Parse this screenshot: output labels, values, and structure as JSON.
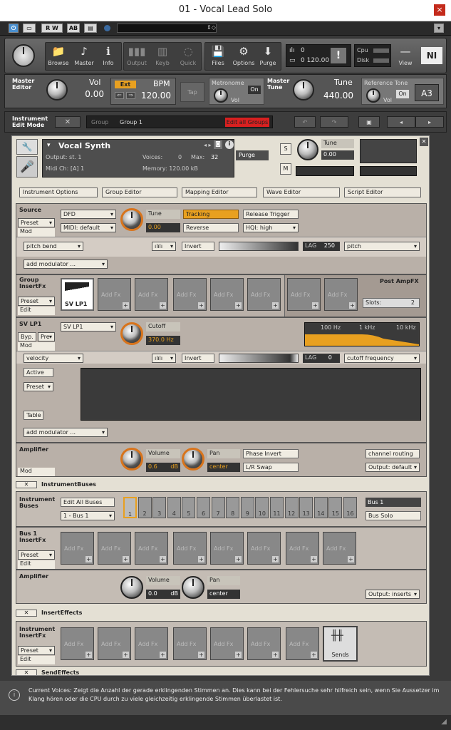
{
  "window": {
    "title": "01 - Vocal Lead Solo",
    "close": "×"
  },
  "toolbar": {
    "rw": "R W",
    "ab": "AB"
  },
  "tools": [
    {
      "label": "Browse",
      "icon": "📁"
    },
    {
      "label": "Master",
      "icon": "♪"
    },
    {
      "label": "Info",
      "icon": "ℹ"
    },
    {
      "label": "Output",
      "icon": "▮▮▮"
    },
    {
      "label": "Keyb",
      "icon": "▥"
    },
    {
      "label": "Quick",
      "icon": "◌"
    },
    {
      "label": "Files",
      "icon": "💾"
    },
    {
      "label": "Options",
      "icon": "⚙"
    },
    {
      "label": "Purge",
      "icon": "⬇"
    }
  ],
  "memory": {
    "voices": "0",
    "mem": "0  120.00 kB"
  },
  "cpu": {
    "cpu": "Cpu",
    "disk": "Disk"
  },
  "view": {
    "label": "View"
  },
  "master": {
    "editor_label": "Master Editor",
    "vol_label": "Vol",
    "vol": "0.00",
    "ext": "Ext",
    "bpm_label": "BPM",
    "bpm": "120.00",
    "tap": "Tap",
    "metronome": "Metronome",
    "on": "On",
    "met_vol": "Vol",
    "tune_label_l": "Master Tune",
    "tune_label": "Tune",
    "tune": "440.00",
    "ref_tone": "Reference Tone",
    "ref_on": "On",
    "ref_vol": "Vol",
    "ref_note": "A3"
  },
  "editmode": {
    "label": "Instrument Edit Mode",
    "group_lbl": "Group",
    "group": "Group 1",
    "edit_all": "Edit all Groups"
  },
  "instrument": {
    "name": "Vocal Synth",
    "output": "Output: st. 1",
    "voices": "Voices:",
    "voices_v": "0",
    "max": "Max:",
    "max_v": "32",
    "purge": "Purge",
    "midi": "Midi Ch: [A]  1",
    "memory": "Memory: 120.00 kB",
    "s": "S",
    "m": "M",
    "tune_lbl": "Tune",
    "tune_v": "0.00"
  },
  "tabs": [
    "Instrument Options",
    "Group Editor",
    "Mapping Editor",
    "Wave Editor",
    "Script Editor"
  ],
  "source": {
    "title": "Source",
    "preset": "Preset",
    "mod": "Mod",
    "mode": "DFD",
    "midi": "MIDI: default",
    "tune_lbl": "Tune",
    "tune_v": "0.00",
    "tracking": "Tracking",
    "reverse": "Reverse",
    "release": "Release Trigger",
    "hqi": "HQI: high",
    "mod_src": "pitch bend",
    "invert": "Invert",
    "lag_lbl": "LAG",
    "lag_v": "250",
    "target": "pitch",
    "add_mod": "add modulator ..."
  },
  "group_fx": {
    "title": "Group InsertFx",
    "preset": "Preset",
    "edit": "Edit",
    "first": "SV LP1",
    "add": "Add Fx",
    "post": "Post AmpFX",
    "slots_lbl": "Slots:",
    "slots": "2"
  },
  "svlp1": {
    "title": "SV LP1",
    "byp": "Byp.",
    "pre": "Pre",
    "mod": "Mod",
    "type": "SV LP1",
    "cutoff_lbl": "Cutoff",
    "cutoff_v": "370.0",
    "cutoff_unit": "Hz",
    "hz100": "100 Hz",
    "khz1": "1 kHz",
    "khz10": "10 kHz",
    "mod_src": "velocity",
    "invert": "Invert",
    "lag_lbl": "LAG",
    "lag_v": "0",
    "target": "cutoff frequency",
    "active": "Active",
    "preset": "Preset",
    "table": "Table",
    "add_mod": "add modulator ..."
  },
  "amp": {
    "title": "Amplifier",
    "mod": "Mod",
    "vol_lbl": "Volume",
    "vol_v": "0.6",
    "vol_unit": "dB",
    "pan_lbl": "Pan",
    "pan_v": "center",
    "phase": "Phase Invert",
    "lr": "L/R Swap",
    "routing": "channel routing",
    "output": "Output: default"
  },
  "buses": {
    "header": "InstrumentBuses",
    "title": "Instrument Buses",
    "edit_all": "Edit All Buses",
    "bus_sel": "1 - Bus 1",
    "numbers": [
      "1",
      "2",
      "3",
      "4",
      "5",
      "6",
      "7",
      "8",
      "9",
      "10",
      "11",
      "12",
      "13",
      "14",
      "15",
      "16"
    ],
    "bus_name": "Bus 1",
    "bus_solo": "Bus Solo",
    "fx_title": "Bus 1 InsertFx",
    "preset": "Preset",
    "edit": "Edit",
    "add": "Add Fx",
    "amp_title": "Amplifier",
    "vol_lbl": "Volume",
    "vol_v": "0.0",
    "vol_unit": "dB",
    "pan_lbl": "Pan",
    "pan_v": "center",
    "output": "Output: inserts"
  },
  "insert": {
    "header": "InsertEffects",
    "title": "Instrument InsertFx",
    "preset": "Preset",
    "edit": "Edit",
    "add": "Add Fx",
    "sends": "Sends"
  },
  "send": {
    "header": "SendEffects"
  },
  "status": {
    "text": "Current Voices: Zeigt die Anzahl der gerade erklingenden Stimmen an. Dies kann bei der Fehlersuche sehr hilfreich sein, wenn Sie Aussetzer im Klang hören oder die CPU durch zu viele gleichzeitig erklingende Stimmen überlastet ist."
  }
}
